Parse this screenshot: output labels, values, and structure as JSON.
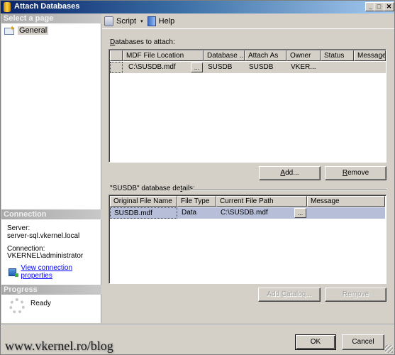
{
  "window": {
    "title": "Attach Databases",
    "controls": {
      "minimize": "_",
      "maximize": "□",
      "close": "✕"
    }
  },
  "left_pane": {
    "select_page_header": "Select a page",
    "pages": [
      {
        "label": "General",
        "icon": "general-page-icon",
        "selected": true
      }
    ],
    "connection": {
      "header": "Connection",
      "server_label": "Server:",
      "server_value": "server-sql.vkernel.local",
      "connection_label": "Connection:",
      "connection_value": "VKERNEL\\administrator",
      "view_properties_link": "View connection properties"
    },
    "progress": {
      "header": "Progress",
      "status": "Ready"
    }
  },
  "toolbar": {
    "script_label": "Script",
    "script_dropdown": "▾",
    "help_label": "Help"
  },
  "attach_section": {
    "label": "Databases to attach:",
    "label_accel": "D",
    "label_rest": "atabases to attach:",
    "columns": [
      "",
      "MDF File Location",
      "Database ...",
      "Attach As",
      "Owner",
      "Status",
      "Message"
    ],
    "rows": [
      {
        "selector": "",
        "mdf_location": "C:\\SUSDB.mdf",
        "browse": "...",
        "database": "SUSDB",
        "attach_as": "SUSDB",
        "owner": "VKER...",
        "status": "",
        "message": ""
      }
    ],
    "add_button": {
      "accel": "A",
      "rest": "dd..."
    },
    "remove_button": {
      "accel": "R",
      "rest": "emove"
    }
  },
  "details_section": {
    "label_pre": "\"SUSDB\" database de",
    "label_accel": "t",
    "label_post": "ails:",
    "columns": [
      "Original File Name",
      "File Type",
      "Current File Path",
      "Message"
    ],
    "rows": [
      {
        "original_file": "SUSDB.mdf",
        "file_type": "Data",
        "current_path": "C:\\SUSDB.mdf",
        "browse": "...",
        "message": ""
      }
    ],
    "add_catalog_button": {
      "pre": "Add ",
      "accel": "C",
      "post": "atalog...",
      "enabled": false
    },
    "remove_button": {
      "pre": "Re",
      "accel": "m",
      "post": "ove",
      "enabled": false
    }
  },
  "footer": {
    "ok_label": "OK",
    "cancel_label": "Cancel",
    "watermark": "www.vkernel.ro/blog"
  },
  "colors": {
    "title_gradient_start": "#0a246a",
    "title_gradient_end": "#a6caf0",
    "dialog_bg": "#d4d0c8",
    "selected_row": "#b6bed8",
    "link": "#0000ff"
  }
}
